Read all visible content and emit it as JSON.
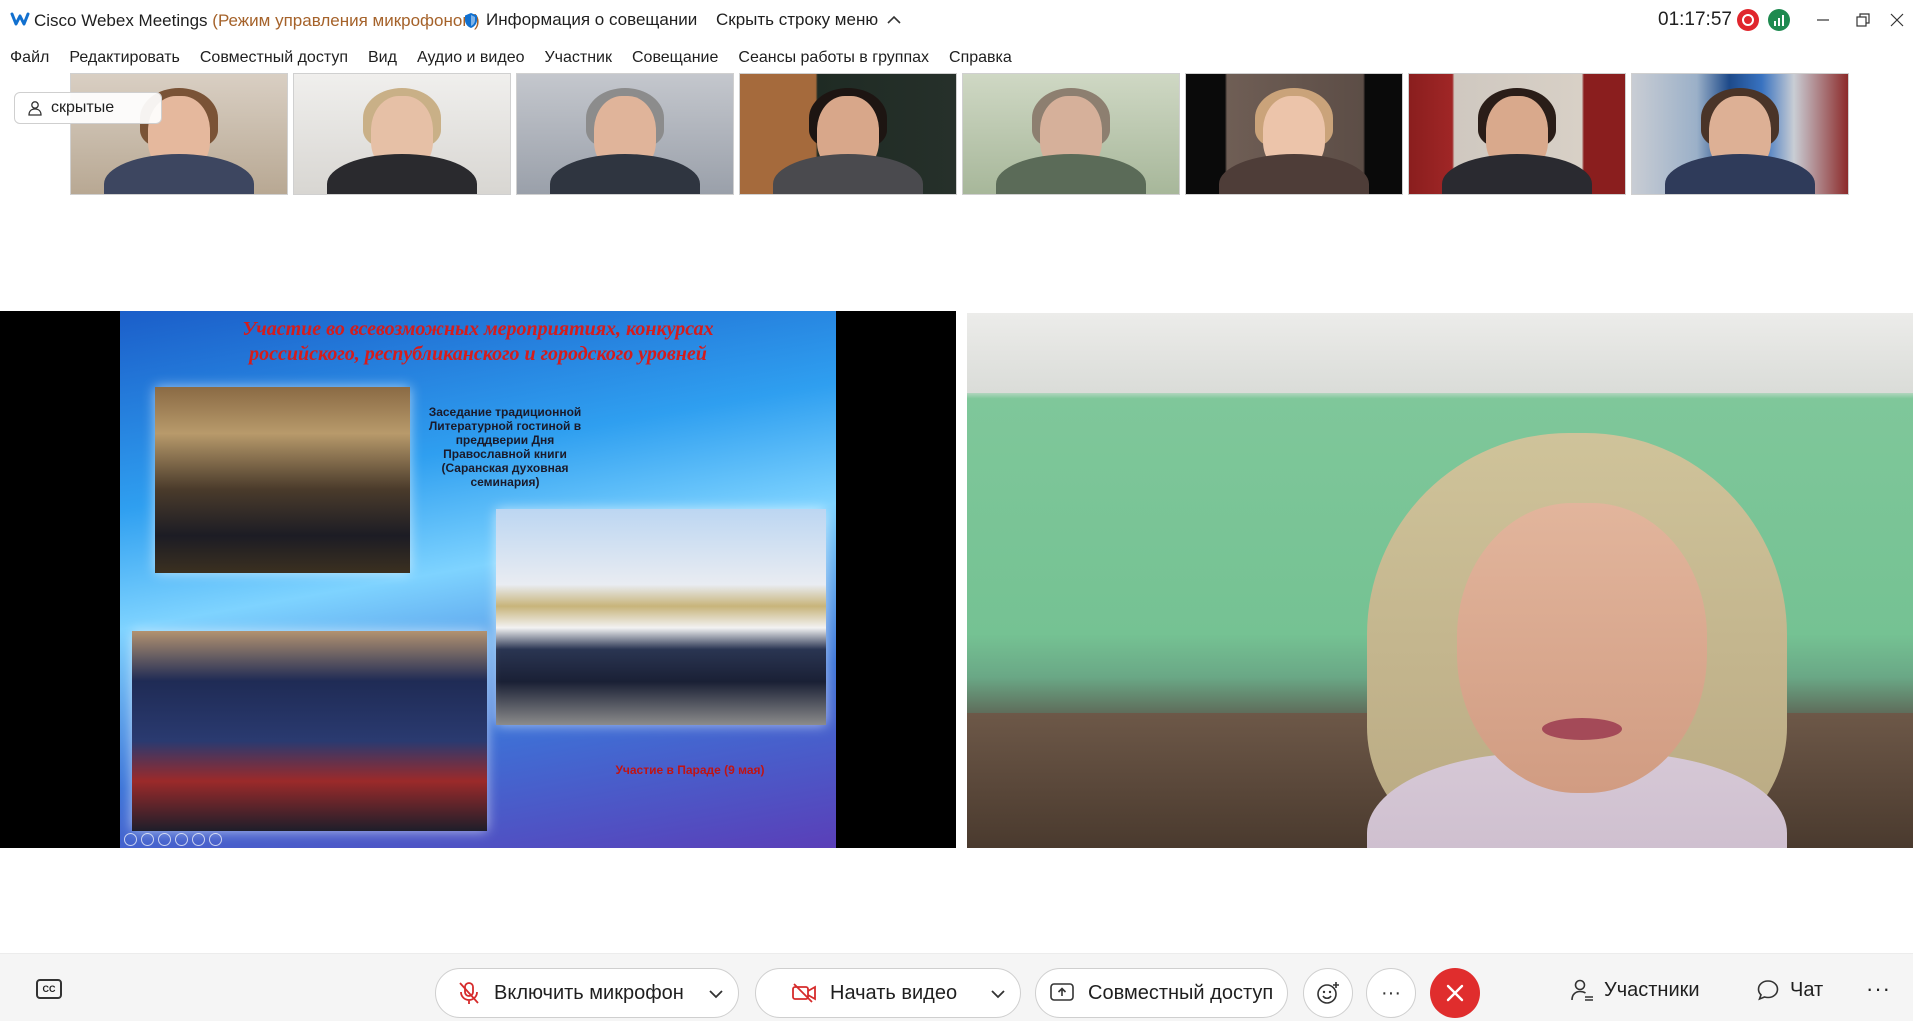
{
  "titlebar": {
    "app_name": "Cisco Webex Meetings",
    "mode": "(Режим управления микрофоном)",
    "meeting_info": "Информация о совещании",
    "hide_menu": "Скрыть строку меню",
    "timer": "01:17:57"
  },
  "menu": {
    "items": [
      "Файл",
      "Редактировать",
      "Совместный доступ",
      "Вид",
      "Аудио и видео",
      "Участник",
      "Совещание",
      "Сеансы работы в группах",
      "Справка"
    ]
  },
  "filmstrip": {
    "hidden_label": "скрытые"
  },
  "slide": {
    "title_line1": "Участие во всевозможных мероприятиях, конкурсах",
    "title_line2": "российского, республиканского и городского уровней",
    "caption1": "Заседание традиционной Литературной гостиной в преддверии Дня Православной книги (Саранская духовная семинария)",
    "caption2": "Участие в Параде (9 мая)"
  },
  "toolbar": {
    "mic_label": "Включить микрофон",
    "video_label": "Начать видео",
    "share_label": "Совместный доступ",
    "participants_label": "Участники",
    "chat_label": "Чат",
    "more_label": "···",
    "cc_label": "CC"
  },
  "colors": {
    "record": "#e0262d",
    "end_call": "#e02d2d",
    "mode_text": "#a5622a",
    "slide_title": "#d51c1c"
  }
}
